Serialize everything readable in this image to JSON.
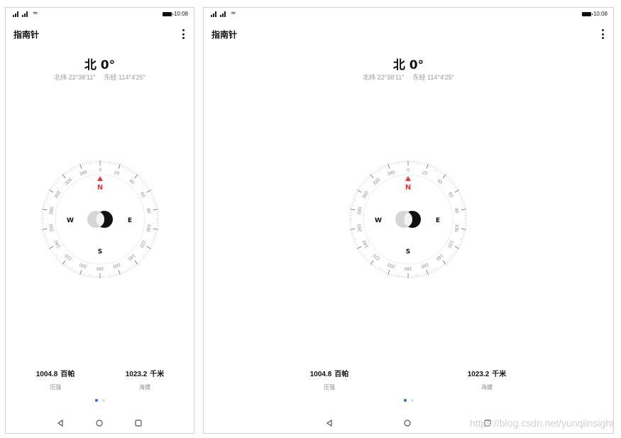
{
  "status_bar": {
    "time": "10:08"
  },
  "app": {
    "title": "指南针",
    "more_icon": "more-vertical-icon"
  },
  "heading": {
    "text": "北 0°"
  },
  "location": {
    "latitude": "北纬 22°38′11″",
    "longitude": "东经 114°4′25″"
  },
  "compass": {
    "ticks": [
      "0",
      "20",
      "40",
      "60",
      "80",
      "100",
      "120",
      "140",
      "160",
      "180",
      "200",
      "220",
      "240",
      "260",
      "280",
      "300",
      "320",
      "340"
    ],
    "north": "N",
    "east": "E",
    "south": "S",
    "west": "W",
    "heading_degrees": 0,
    "north_color": "#e53935"
  },
  "readings": {
    "pressure": {
      "value": "1004.8",
      "unit": "百帕",
      "label": "压强"
    },
    "altitude": {
      "value": "1023.2",
      "unit": "千米",
      "label": "海拔"
    }
  },
  "pager": {
    "count": 2,
    "active": 0,
    "active_color": "#1a73e8"
  },
  "nav": {
    "back": "back-triangle-icon",
    "home": "home-circle-icon",
    "recent": "recent-square-icon"
  },
  "watermark": "https://blog.csdn.net/yunqiinsight"
}
